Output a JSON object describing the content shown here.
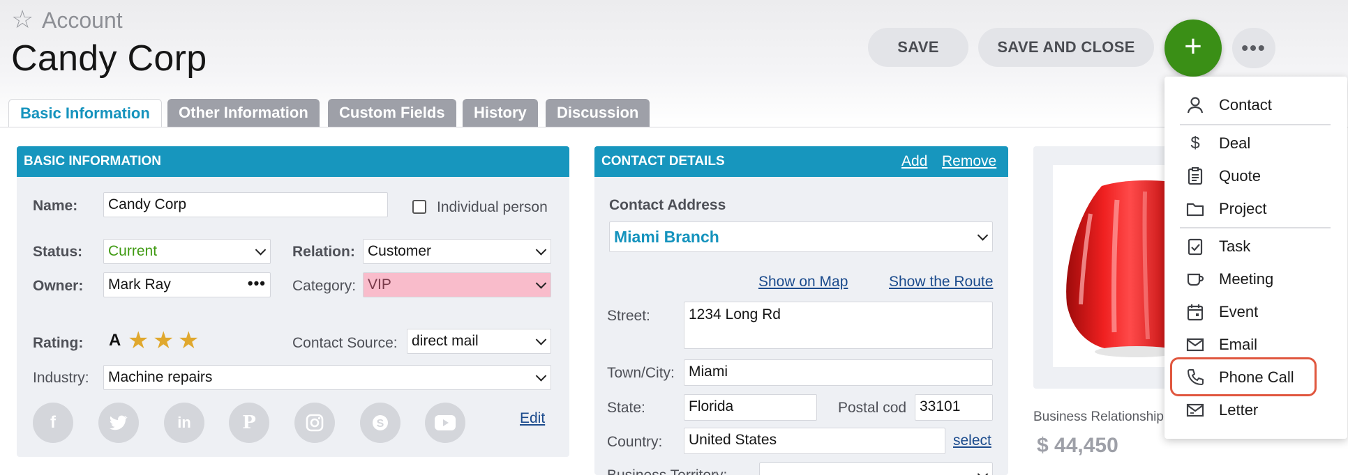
{
  "header": {
    "entity_type": "Account",
    "title": "Candy Corp",
    "save_label": "SAVE",
    "save_close_label": "SAVE AND CLOSE",
    "add_label": "+",
    "more_label": "•••"
  },
  "tabs": [
    {
      "label": "Basic Information",
      "active": true
    },
    {
      "label": "Other Information",
      "active": false
    },
    {
      "label": "Custom Fields",
      "active": false
    },
    {
      "label": "History",
      "active": false
    },
    {
      "label": "Discussion",
      "active": false
    }
  ],
  "basic": {
    "heading": "BASIC INFORMATION",
    "name_label": "Name:",
    "name_value": "Candy Corp",
    "individual_label": "Individual person",
    "status_label": "Status:",
    "status_value": "Current",
    "relation_label": "Relation:",
    "relation_value": "Customer",
    "owner_label": "Owner:",
    "owner_value": "Mark Ray",
    "category_label": "Category:",
    "category_value": "VIP",
    "rating_label": "Rating:",
    "rating_grade": "A",
    "rating_stars": 3,
    "contact_source_label": "Contact Source:",
    "contact_source_value": "direct mail",
    "industry_label": "Industry:",
    "industry_value": "Machine repairs",
    "edit_label": "Edit",
    "social_icons": [
      "facebook-icon",
      "twitter-icon",
      "linkedin-icon",
      "pinterest-icon",
      "instagram-icon",
      "skype-icon",
      "youtube-icon"
    ]
  },
  "contact": {
    "heading": "CONTACT DETAILS",
    "add_label": "Add",
    "remove_label": "Remove",
    "address_label": "Contact Address",
    "address_value": "Miami Branch",
    "show_map": "Show on Map",
    "show_route": "Show the Route",
    "street_label": "Street:",
    "street_value": "1234 Long Rd",
    "town_label": "Town/City:",
    "town_value": "Miami",
    "state_label": "State:",
    "state_value": "Florida",
    "postal_label": "Postal cod",
    "postal_value": "33101",
    "country_label": "Country:",
    "country_value": "United States",
    "select_label": "select",
    "territory_label": "Business Territory:"
  },
  "business": {
    "label": "Business Relationship",
    "value": "$ 44,450"
  },
  "menu": {
    "items": [
      {
        "label": "Contact",
        "icon": "person-icon"
      },
      {
        "label": "Deal",
        "icon": "dollar-icon"
      },
      {
        "label": "Quote",
        "icon": "clipboard-icon"
      },
      {
        "label": "Project",
        "icon": "folder-icon"
      },
      {
        "label": "Task",
        "icon": "task-check-icon"
      },
      {
        "label": "Meeting",
        "icon": "meeting-cup-icon"
      },
      {
        "label": "Event",
        "icon": "calendar-icon"
      },
      {
        "label": "Email",
        "icon": "mail-icon"
      },
      {
        "label": "Phone Call",
        "icon": "phone-icon"
      },
      {
        "label": "Letter",
        "icon": "letter-icon"
      }
    ]
  },
  "colors": {
    "accent": "#1796be",
    "add_button": "#3a8f16",
    "status_current": "#3f9a12",
    "category_vip_bg": "#f9bccb",
    "highlight": "#e0573f"
  }
}
